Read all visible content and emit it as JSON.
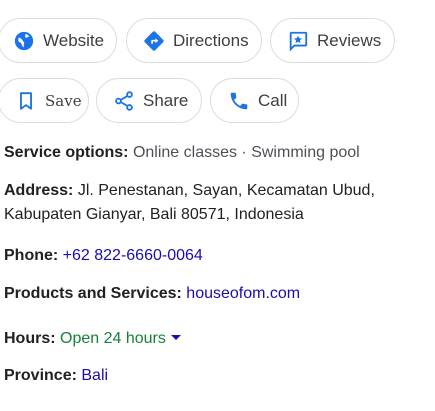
{
  "actions_row1": [
    {
      "label": "Website",
      "icon": "globe-icon"
    },
    {
      "label": "Directions",
      "icon": "directions-icon"
    },
    {
      "label": "Reviews",
      "icon": "reviews-icon"
    }
  ],
  "actions_row2": [
    {
      "label": "Save",
      "icon": "bookmark-icon"
    },
    {
      "label": "Share",
      "icon": "share-icon"
    },
    {
      "label": "Call",
      "icon": "phone-icon"
    }
  ],
  "details": {
    "service_options": {
      "label": "Service options:",
      "value": "Online classes · Swimming pool"
    },
    "address": {
      "label": "Address:",
      "line1": "Jl. Penestanan, Sayan, Kecamatan Ubud,",
      "line2": "Kabupaten Gianyar, Bali 80571, Indonesia"
    },
    "phone": {
      "label": "Phone:",
      "value": "+62 822-6660-0064"
    },
    "products": {
      "label": "Products and Services:",
      "value": "houseofom.com"
    },
    "hours": {
      "label": "Hours:",
      "value": "Open 24 hours"
    },
    "province": {
      "label": "Province:",
      "value": "Bali"
    }
  },
  "colors": {
    "accent_blue": "#1a73e8",
    "link": "#1a0dab",
    "open_green": "#188038",
    "chip_border": "#dadce0"
  }
}
